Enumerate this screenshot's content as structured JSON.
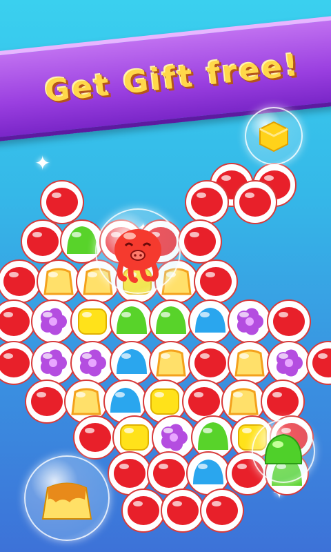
{
  "banner": {
    "text": "Get Gift free!"
  },
  "colors": {
    "red": "#e8202a",
    "green": "#58d32a",
    "yellow": "#ffe21a",
    "orange": "#f4a11c",
    "purple": "#b44de0",
    "blue": "#2aa6ee",
    "tile_bg": "#ffffff",
    "tile_border": "#d83a3a"
  },
  "board": {
    "rows": [
      [
        "red",
        "red"
      ],
      [
        "red",
        "red",
        "red"
      ],
      [
        "red",
        "green",
        "red",
        "red",
        "red"
      ],
      [
        "red",
        "orange",
        "orange",
        "yellow",
        "orange",
        "red"
      ],
      [
        "red",
        "purple",
        "yellow",
        "green",
        "green",
        "blue",
        "purple",
        "red"
      ],
      [
        "red",
        "purple",
        "purple",
        "blue",
        "orange",
        "red",
        "orange",
        "purple",
        "red"
      ],
      [
        "red",
        "orange",
        "blue",
        "yellow",
        "red",
        "orange",
        "red"
      ],
      [
        "red",
        "yellow",
        "purple",
        "green",
        "yellow",
        "red"
      ],
      [
        "red",
        "red",
        "blue",
        "red",
        "green"
      ],
      [
        "red",
        "red",
        "red"
      ]
    ],
    "special": {
      "center_bubble": "octopus-red",
      "top_right_bubble": "yellow-cube",
      "right_bubble": "green-gumdrop",
      "bottom_left_bubble": "pudding"
    }
  }
}
